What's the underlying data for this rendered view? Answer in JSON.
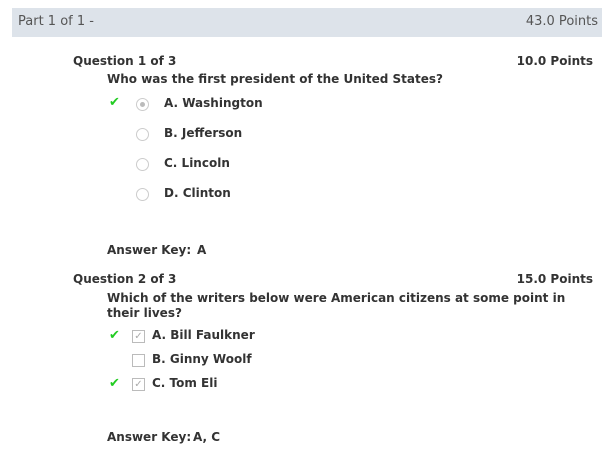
{
  "part": {
    "title": "Part 1 of 1 -",
    "points": "43.0 Points"
  },
  "questions": [
    {
      "title": "Question 1 of 3",
      "points": "10.0 Points",
      "text": "Who was the first president of the United States?",
      "options": [
        {
          "label": "A. Washington",
          "selected": true,
          "correct": true
        },
        {
          "label": "B. Jefferson"
        },
        {
          "label": "C. Lincoln"
        },
        {
          "label": "D. Clinton"
        }
      ],
      "answer_key_label": "Answer Key:",
      "answer_key": "A"
    },
    {
      "title": "Question 2 of 3",
      "points": "15.0 Points",
      "text_line1": "Which of the writers below were American citizens at some point in",
      "text_line2": "their lives?",
      "options": [
        {
          "label": "A. Bill Faulkner",
          "selected": true,
          "correct": true
        },
        {
          "label": "B. Ginny Woolf"
        },
        {
          "label": "C. Tom Eli",
          "selected": true,
          "correct": true
        }
      ],
      "answer_key_label": "Answer Key:",
      "answer_key": "A, C"
    }
  ],
  "colors": {
    "header_bg": "#dde3ea",
    "correct": "#22cc22"
  }
}
